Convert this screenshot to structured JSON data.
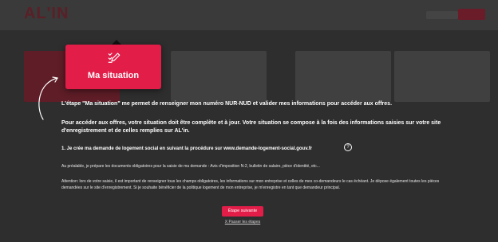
{
  "background": {
    "logo": "AL'IN"
  },
  "tutorial": {
    "tile_label": "Ma situation",
    "tile_icon": "checklist-pencil-icon",
    "intro": "L'étape \"Ma situation\" me permet de renseigner mon numéro NUR-NUD et valider mes informations pour accéder aux offres.",
    "requirement": "Pour accéder aux offres, votre situation doit être complète et à jour. Votre situation se compose à la fois des informations saisies sur votre site d'enregistrement et de celles remplies sur AL'in.",
    "step1": "1. Je crée ma demande de logement social en suivant la procédure sur www.demande-logement-social.gouv.fr",
    "help_icon": "question-circle-icon",
    "prep": "Au préalable, je prépare les documents obligatoires pour la saisie de ma demande : Avis d'imposition N-2, bulletin de salaire, pièce d'identité, etc...",
    "attention": "Attention: lors de votre saisie, il est important de renseigner tous les champs obligatoires, les informations sur mon entreprise et celles de mes co-demandeurs le cas échéant. Je dépose également toutes les pièces demandées sur le site d'enregistrement. Si je souhaite bénéficier de la politique logement de mon entreprise, je m'enregistre en tant que demandeur principal.",
    "next_button": "Étape suivante",
    "skip_link": "X Passer les étapes"
  },
  "colors": {
    "accent": "#e11d48",
    "overlay": "#2e2e2e"
  }
}
